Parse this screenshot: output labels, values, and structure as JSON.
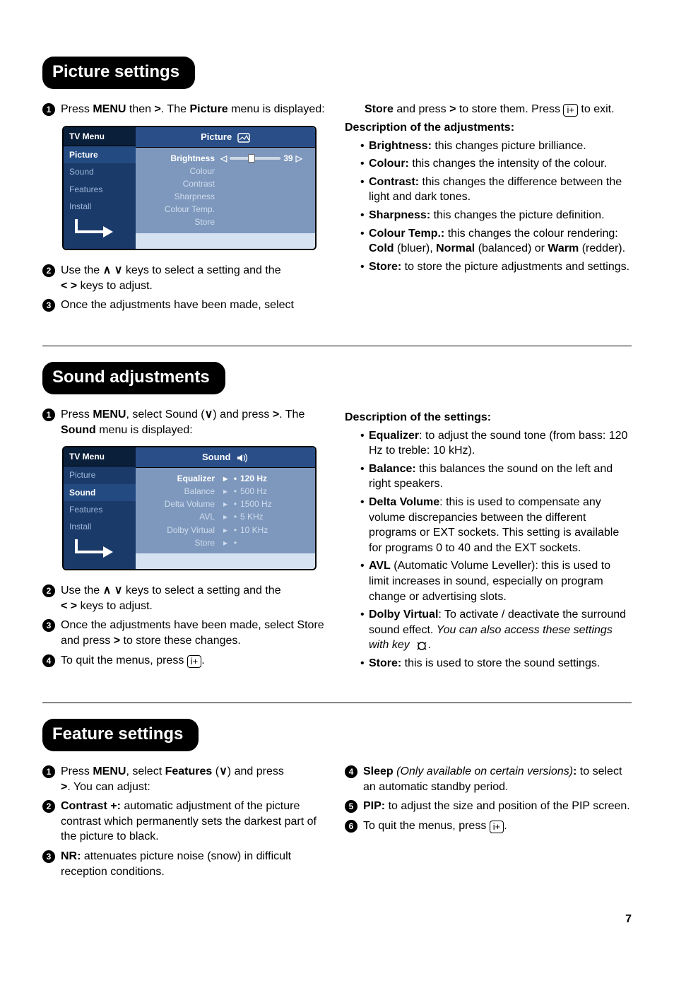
{
  "sections": {
    "picture": {
      "heading": "Picture settings",
      "steps": {
        "s1a": "Press ",
        "s1b": "MENU",
        "s1c": " then ",
        "s1d": ". The ",
        "s1e": "Picture",
        "s1f": " menu is displayed:",
        "s2a": "Use the ",
        "s2b": " keys to select a setting and the ",
        "s2c": " keys to adjust.",
        "s3": "Once the adjustments have been made, select ",
        "s3b": "Store",
        "s3c": " and press ",
        "s3d": " to store them. Press ",
        "s3e": " to exit."
      },
      "menu": {
        "left_title": "TV Menu",
        "left_items": [
          "Picture",
          "Sound",
          "Features",
          "Install"
        ],
        "right_title": "Picture",
        "rows": [
          {
            "label": "Brightness",
            "value": "39",
            "active": true,
            "slider": true
          },
          {
            "label": "Colour"
          },
          {
            "label": "Contrast"
          },
          {
            "label": "Sharpness"
          },
          {
            "label": "Colour Temp."
          },
          {
            "label": "Store"
          }
        ]
      },
      "desc_head": "Description of the adjustments:",
      "desc": [
        {
          "t1": "Brightness:",
          "t2": " this changes picture brilliance."
        },
        {
          "t1": "Colour:",
          "t2": " this changes the intensity of the colour."
        },
        {
          "t1": "Contrast:",
          "t2": " this changes the difference between the light and dark tones."
        },
        {
          "t1": "Sharpness:",
          "t2": " this changes the picture definition."
        },
        {
          "t1": "Colour Temp.:",
          "t2": " this changes the colour rendering: ",
          "t3": "Cold",
          "t4": " (bluer), ",
          "t5": "Normal",
          "t6": " (balanced) or ",
          "t7": "Warm",
          "t8": " (redder)."
        },
        {
          "t1": "Store:",
          "t2": " to store the picture adjustments and settings."
        }
      ]
    },
    "sound": {
      "heading": "Sound adjustments",
      "steps": {
        "s1a": "Press ",
        "s1b": "MENU",
        "s1c": ", select Sound (",
        "s1d": ") and press ",
        "s1e": ". The ",
        "s1f": "Sound",
        "s1g": " menu is displayed:",
        "s2a": "Use the ",
        "s2b": " keys to select a setting and the ",
        "s2c": " keys to adjust.",
        "s3a": "Once the adjustments have been made, select Store and press ",
        "s3b": " to store these changes.",
        "s4a": "To quit the menus, press ",
        "s4b": "."
      },
      "menu": {
        "left_title": "TV Menu",
        "left_items": [
          "Picture",
          "Sound",
          "Features",
          "Install"
        ],
        "right_title": "Sound",
        "rows": [
          {
            "label": "Equalizer",
            "mark": "▸",
            "value": "120 Hz",
            "active": true
          },
          {
            "label": "Balance",
            "mark": "▸",
            "value": "500 Hz"
          },
          {
            "label": "Delta Volume",
            "mark": "▸",
            "value": "1500 Hz"
          },
          {
            "label": "AVL",
            "mark": "▸",
            "value": "5 KHz"
          },
          {
            "label": "Dolby Virtual",
            "mark": "▸",
            "value": "10 KHz"
          },
          {
            "label": "Store",
            "mark": "▸",
            "value": ""
          }
        ]
      },
      "desc_head": "Description of the settings:",
      "desc": [
        {
          "t1": "Equalizer",
          "t2": ": to adjust the sound tone (from bass: 120 Hz to treble: 10 kHz)."
        },
        {
          "t1": "Balance:",
          "t2": " this balances the sound on the left and right speakers."
        },
        {
          "t1": "Delta Volume",
          "t2": ": this is used to compensate any volume discrepancies between the different programs or EXT sockets. This setting is available for programs 0 to 40 and the EXT sockets."
        },
        {
          "t1": "AVL",
          "t2": " (Automatic Volume Leveller): this is used to limit increases in sound, especially on program change or advertising slots."
        },
        {
          "t1": "Dolby Virtual",
          "t2": ": To activate / deactivate the surround sound effect. ",
          "t3": "You can also access these settings with key ",
          "t4": "."
        },
        {
          "t1": "Store:",
          "t2": " this is used to store the sound settings."
        }
      ]
    },
    "features": {
      "heading": "Feature settings",
      "left_steps": {
        "s1a": "Press ",
        "s1b": "MENU",
        "s1c": ", select ",
        "s1d": "Features",
        "s1e": " (",
        "s1f": ") and press ",
        "s1g": ". You can adjust:",
        "s2a": "Contrast +:",
        "s2b": " automatic adjustment of the picture contrast which permanently sets the darkest part of the picture to black.",
        "s3a": "NR:",
        "s3b": " attenuates picture noise (snow) in difficult reception conditions."
      },
      "right_steps": {
        "s4a": "Sleep",
        "s4b": " (Only available on certain versions)",
        "s4c": ":",
        "s4d": " to select an automatic standby period.",
        "s5a": "PIP:",
        "s5b": " to adjust the size and position of the PIP screen.",
        "s6a": "To quit the menus, press ",
        "s6b": "."
      }
    }
  },
  "glyphs": {
    "right": "≥",
    "left": "≤",
    "up": "∧",
    "down": "∨",
    "updown": "∧ ∨",
    "leftright": "≤ ≥"
  },
  "page_number": "7"
}
